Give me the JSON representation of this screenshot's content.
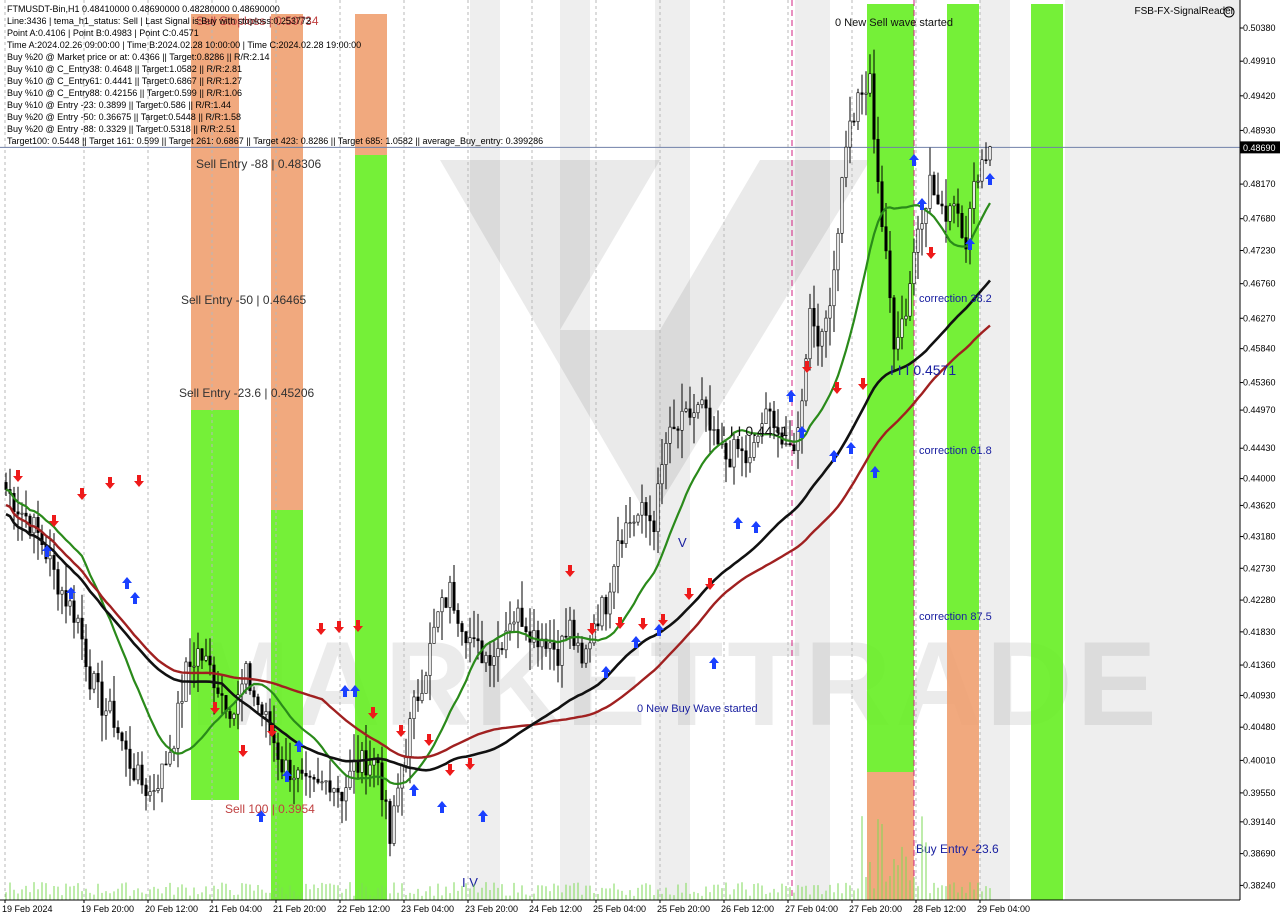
{
  "header": {
    "symbol_line": "FTMUSDT-Bin,H1  0.48410000 0.48690000 0.48280000 0.48690000",
    "lines": [
      "Line:3436 | tema_h1_status: Sell | Last Signal is:Buy with stoploss:0.253772",
      "Point A:0.4106 | Point B:0.4983 | Point C:0.4571",
      "Time A:2024.02.26 09:00:00 | Time B:2024.02.28 10:00:00 | Time C:2024.02.28 19:00:00",
      "Buy %20 @ Market price or at: 0.4366 || Target:0.8286 || R/R:2.14",
      "Buy %10 @ C_Entry38: 0.4648 || Target:1.0582 || R/R:2.81",
      "Buy %10 @ C_Entry61: 0.4441 || Target:0.6867 || R/R:1.27",
      "Buy %10 @ C_Entry88: 0.42156 || Target:0.599 || R/R:1.06",
      "Buy %10 @ Entry -23: 0.3899 || Target:0.586 || R/R:1.44",
      "Buy %20 @ Entry -50: 0.36675 || Target:0.5448 || R/R:1.58",
      "Buy %20 @ Entry -88: 0.3329 || Target:0.5318 || R/R:2.51",
      "Target100: 0.5448 || Target 161: 0.599 || Target 261: 0.6867 || Target 423: 0.8286 || Target 685: 1.0582 || average_Buy_entry: 0.399286"
    ],
    "brand": "FSB-FX-SignalReader"
  },
  "chart_data": {
    "type": "candlestick",
    "symbol": "FTMUSDT-Bin",
    "timeframe": "H1",
    "ylim": [
      0.3809,
      0.5072
    ],
    "current_price": "0.48690",
    "y_ticks": [
      "0.50380",
      "0.49910",
      "0.49420",
      "0.48930",
      "0.48690",
      "0.48170",
      "0.47680",
      "0.47230",
      "0.46760",
      "0.46270",
      "0.45840",
      "0.45360",
      "0.44970",
      "0.44430",
      "0.44000",
      "0.43620",
      "0.43180",
      "0.42730",
      "0.42280",
      "0.41830",
      "0.41360",
      "0.40930",
      "0.40480",
      "0.40010",
      "0.39550",
      "0.39140",
      "0.38690",
      "0.38240"
    ],
    "x_ticks": [
      "19 Feb 2024",
      "19 Feb 20:00",
      "20 Feb 12:00",
      "21 Feb 04:00",
      "21 Feb 20:00",
      "22 Feb 12:00",
      "23 Feb 04:00",
      "23 Feb 20:00",
      "24 Feb 12:00",
      "25 Feb 04:00",
      "25 Feb 20:00",
      "26 Feb 12:00",
      "27 Feb 04:00",
      "27 Feb 20:00",
      "28 Feb 12:00",
      "29 Feb 04:00"
    ],
    "price_path": [
      0.4385,
      0.436,
      0.434,
      0.431,
      0.4265,
      0.423,
      0.42,
      0.412,
      0.408,
      0.406,
      0.401,
      0.3975,
      0.3955,
      0.3985,
      0.4035,
      0.4125,
      0.4155,
      0.413,
      0.4095,
      0.407,
      0.412,
      0.408,
      0.4045,
      0.3995,
      0.3985,
      0.396,
      0.396,
      0.3975,
      0.3955,
      0.399,
      0.4,
      0.4,
      0.3885,
      0.3995,
      0.4075,
      0.4135,
      0.4205,
      0.424,
      0.42,
      0.416,
      0.415,
      0.416,
      0.4205,
      0.4205,
      0.418,
      0.4175,
      0.4155,
      0.419,
      0.413,
      0.42,
      0.4225,
      0.432,
      0.434,
      0.435,
      0.434,
      0.445,
      0.447,
      0.449,
      0.45,
      0.445,
      0.443,
      0.444,
      0.442,
      0.448,
      0.449,
      0.443,
      0.4465,
      0.464,
      0.459,
      0.47,
      0.488,
      0.493,
      0.496,
      0.476,
      0.46,
      0.464,
      0.476,
      0.482,
      0.477,
      0.48,
      0.474,
      0.484,
      0.487
    ],
    "legend_labels": {
      "sell_entry_88": "Sell Entry -88 | 0.48306",
      "sell_entry_50": "Sell Entry -50 | 0.46465",
      "sell_entry_23": "Sell Entry -23.6 | 0.45206",
      "sell_100": "Sell 100 | 0.3954",
      "sell_stoploss": "Sell Stoploss | 0.50734",
      "new_sell_wave": "0 New Sell wave started",
      "new_buy_wave": "0 New Buy Wave started",
      "wave_iii_a": "I I I 0.4431",
      "wave_iii_b": "I I I 0.4571",
      "wave_iv": "I V",
      "wave_v": "V",
      "corr_382": "correction 38.2",
      "corr_618": "correction 61.8",
      "corr_875": "correction 87.5",
      "buy_entry_23": "Buy Entry -23.6"
    },
    "colors": {
      "green_zone": "#66ee22",
      "orange_zone": "#f0a070",
      "ma_green": "#2a8a1a",
      "ma_black": "#111111",
      "ma_red": "#a02020",
      "up_arrow": "#1a40ff",
      "down_arrow": "#ee1a1a"
    }
  }
}
